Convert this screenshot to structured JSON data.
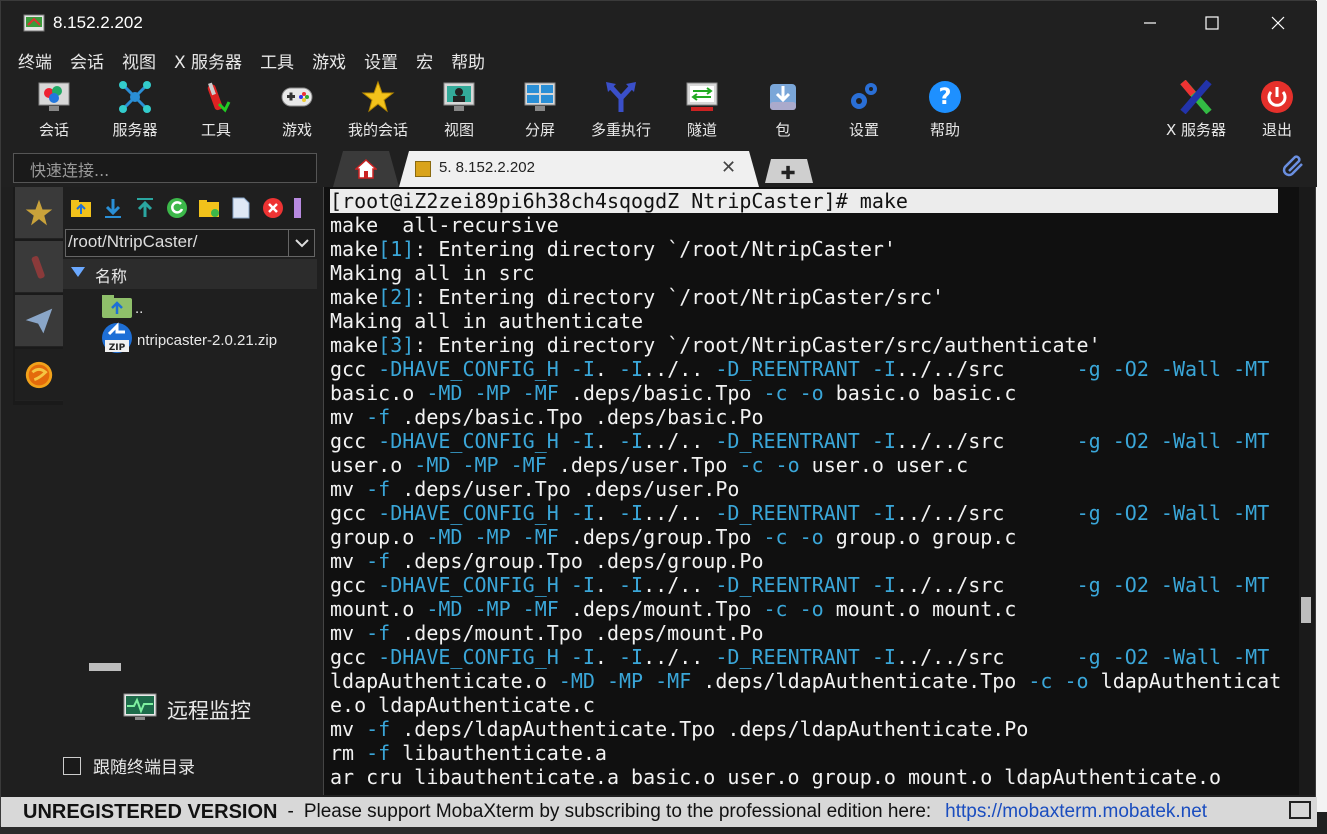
{
  "window": {
    "title": "8.152.2.202"
  },
  "menu": [
    "终端",
    "会话",
    "视图",
    "X 服务器",
    "工具",
    "游戏",
    "设置",
    "宏",
    "帮助"
  ],
  "toolbar": {
    "items": [
      {
        "label": "会话",
        "icon": "session-monitor-icon"
      },
      {
        "label": "服务器",
        "icon": "servers-network-icon"
      },
      {
        "label": "工具",
        "icon": "tools-knife-icon"
      },
      {
        "label": "游戏",
        "icon": "gamepad-icon"
      },
      {
        "label": "我的会话",
        "icon": "star-icon"
      },
      {
        "label": "视图",
        "icon": "view-monitor-icon"
      },
      {
        "label": "分屏",
        "icon": "split-screen-icon"
      },
      {
        "label": "多重执行",
        "icon": "multi-exec-fork-icon"
      },
      {
        "label": "隧道",
        "icon": "tunnel-icon"
      },
      {
        "label": "包",
        "icon": "package-download-icon"
      },
      {
        "label": "设置",
        "icon": "settings-gears-icon"
      },
      {
        "label": "帮助",
        "icon": "help-question-icon"
      }
    ],
    "xserver_label": "X 服务器",
    "exit_label": "退出"
  },
  "quick_connect": {
    "placeholder": "快速连接..."
  },
  "tabs": {
    "session_label": "5. 8.152.2.202"
  },
  "sftp": {
    "path": "/root/NtripCaster/",
    "column_name": "名称",
    "files": [
      {
        "name": "..",
        "icon": "folder-up-icon"
      },
      {
        "name": "ntripcaster-2.0.21.zip",
        "icon": "zip-file-icon"
      }
    ],
    "remote_monitor_label": "远程监控",
    "follow_terminal_label": "跟随终端目录"
  },
  "terminal": {
    "lines": [
      {
        "hl": true,
        "segs": [
          {
            "t": "[root@iZ2zei89pi6h38ch4sqogdZ NtripCaster]# make"
          }
        ]
      },
      {
        "segs": [
          {
            "t": "make  all-recursive"
          }
        ]
      },
      {
        "segs": [
          {
            "t": "make"
          },
          {
            "t": "[1]",
            "c": 1
          },
          {
            "t": ": Entering directory `/root/NtripCaster'"
          }
        ]
      },
      {
        "segs": [
          {
            "t": "Making all in src"
          }
        ]
      },
      {
        "segs": [
          {
            "t": "make"
          },
          {
            "t": "[2]",
            "c": 1
          },
          {
            "t": ": Entering directory `/root/NtripCaster/src'"
          }
        ]
      },
      {
        "segs": [
          {
            "t": "Making all in authenticate"
          }
        ]
      },
      {
        "segs": [
          {
            "t": "make"
          },
          {
            "t": "[3]",
            "c": 1
          },
          {
            "t": ": Entering directory `/root/NtripCaster/src/authenticate'"
          }
        ]
      },
      {
        "segs": [
          {
            "t": "gcc "
          },
          {
            "t": "-DHAVE_CONFIG_H -I",
            "c": 1
          },
          {
            "t": ". "
          },
          {
            "t": "-I",
            "c": 1
          },
          {
            "t": "../.. "
          },
          {
            "t": "-D_REENTRANT -I",
            "c": 1
          },
          {
            "t": "../../src      "
          },
          {
            "t": "-g -O2 -Wall -MT",
            "c": 1
          }
        ]
      },
      {
        "segs": [
          {
            "t": "basic.o "
          },
          {
            "t": "-MD -MP -MF",
            "c": 1
          },
          {
            "t": " .deps/basic.Tpo "
          },
          {
            "t": "-c -o",
            "c": 1
          },
          {
            "t": " basic.o basic.c"
          }
        ]
      },
      {
        "segs": [
          {
            "t": "mv "
          },
          {
            "t": "-f",
            "c": 1
          },
          {
            "t": " .deps/basic.Tpo .deps/basic.Po"
          }
        ]
      },
      {
        "segs": [
          {
            "t": "gcc "
          },
          {
            "t": "-DHAVE_CONFIG_H -I",
            "c": 1
          },
          {
            "t": ". "
          },
          {
            "t": "-I",
            "c": 1
          },
          {
            "t": "../.. "
          },
          {
            "t": "-D_REENTRANT -I",
            "c": 1
          },
          {
            "t": "../../src      "
          },
          {
            "t": "-g -O2 -Wall -MT",
            "c": 1
          }
        ]
      },
      {
        "segs": [
          {
            "t": "user.o "
          },
          {
            "t": "-MD -MP -MF",
            "c": 1
          },
          {
            "t": " .deps/user.Tpo "
          },
          {
            "t": "-c -o",
            "c": 1
          },
          {
            "t": " user.o user.c"
          }
        ]
      },
      {
        "segs": [
          {
            "t": "mv "
          },
          {
            "t": "-f",
            "c": 1
          },
          {
            "t": " .deps/user.Tpo .deps/user.Po"
          }
        ]
      },
      {
        "segs": [
          {
            "t": "gcc "
          },
          {
            "t": "-DHAVE_CONFIG_H -I",
            "c": 1
          },
          {
            "t": ". "
          },
          {
            "t": "-I",
            "c": 1
          },
          {
            "t": "../.. "
          },
          {
            "t": "-D_REENTRANT -I",
            "c": 1
          },
          {
            "t": "../../src      "
          },
          {
            "t": "-g -O2 -Wall -MT",
            "c": 1
          }
        ]
      },
      {
        "segs": [
          {
            "t": "group.o "
          },
          {
            "t": "-MD -MP -MF",
            "c": 1
          },
          {
            "t": " .deps/group.Tpo "
          },
          {
            "t": "-c -o",
            "c": 1
          },
          {
            "t": " group.o group.c"
          }
        ]
      },
      {
        "segs": [
          {
            "t": "mv "
          },
          {
            "t": "-f",
            "c": 1
          },
          {
            "t": " .deps/group.Tpo .deps/group.Po"
          }
        ]
      },
      {
        "segs": [
          {
            "t": "gcc "
          },
          {
            "t": "-DHAVE_CONFIG_H -I",
            "c": 1
          },
          {
            "t": ". "
          },
          {
            "t": "-I",
            "c": 1
          },
          {
            "t": "../.. "
          },
          {
            "t": "-D_REENTRANT -I",
            "c": 1
          },
          {
            "t": "../../src      "
          },
          {
            "t": "-g -O2 -Wall -MT",
            "c": 1
          }
        ]
      },
      {
        "segs": [
          {
            "t": "mount.o "
          },
          {
            "t": "-MD -MP -MF",
            "c": 1
          },
          {
            "t": " .deps/mount.Tpo "
          },
          {
            "t": "-c -o",
            "c": 1
          },
          {
            "t": " mount.o mount.c"
          }
        ]
      },
      {
        "segs": [
          {
            "t": "mv "
          },
          {
            "t": "-f",
            "c": 1
          },
          {
            "t": " .deps/mount.Tpo .deps/mount.Po"
          }
        ]
      },
      {
        "segs": [
          {
            "t": "gcc "
          },
          {
            "t": "-DHAVE_CONFIG_H -I",
            "c": 1
          },
          {
            "t": ". "
          },
          {
            "t": "-I",
            "c": 1
          },
          {
            "t": "../.. "
          },
          {
            "t": "-D_REENTRANT -I",
            "c": 1
          },
          {
            "t": "../../src      "
          },
          {
            "t": "-g -O2 -Wall -MT",
            "c": 1
          }
        ]
      },
      {
        "segs": [
          {
            "t": "ldapAuthenticate.o "
          },
          {
            "t": "-MD -MP -MF",
            "c": 1
          },
          {
            "t": " .deps/ldapAuthenticate.Tpo "
          },
          {
            "t": "-c -o",
            "c": 1
          },
          {
            "t": " ldapAuthenticat"
          }
        ]
      },
      {
        "segs": [
          {
            "t": "e.o ldapAuthenticate.c"
          }
        ]
      },
      {
        "segs": [
          {
            "t": "mv "
          },
          {
            "t": "-f",
            "c": 1
          },
          {
            "t": " .deps/ldapAuthenticate.Tpo .deps/ldapAuthenticate.Po"
          }
        ]
      },
      {
        "segs": [
          {
            "t": "rm "
          },
          {
            "t": "-f",
            "c": 1
          },
          {
            "t": " libauthenticate.a"
          }
        ]
      },
      {
        "segs": [
          {
            "t": "ar cru libauthenticate.a basic.o user.o group.o mount.o ldapAuthenticate.o"
          }
        ]
      }
    ]
  },
  "statusbar": {
    "unregistered": "UNREGISTERED VERSION",
    "dash": "-",
    "message": "Please support MobaXterm by subscribing to the professional edition here:",
    "link": "https://mobaxterm.mobatek.net"
  },
  "colors": {
    "terminal_cyan": "#3aa6d8",
    "terminal_bg": "#101010"
  }
}
